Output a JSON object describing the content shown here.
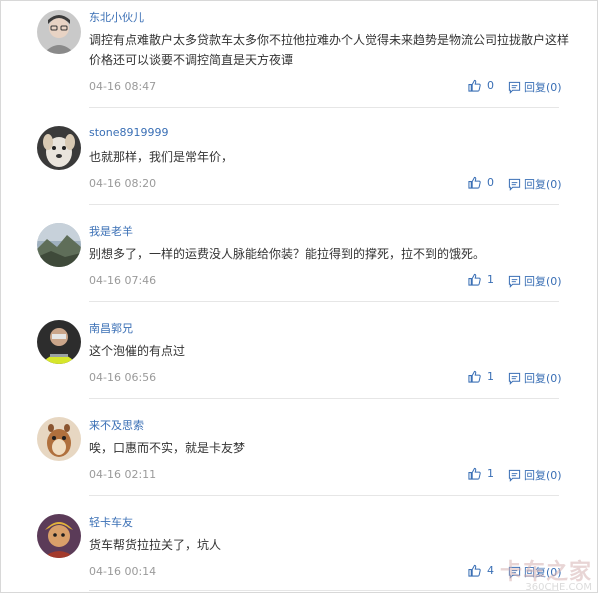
{
  "comments": [
    {
      "avatar": "avatar-person-glasses",
      "username": "东北小伙儿",
      "text": "调控有点难散户太多贷款车太多你不拉他拉难办个人觉得未来趋势是物流公司拉拢散户这样价格还可以谈要不调控简直是天方夜谭",
      "time": "04-16 08:47",
      "likes": "0",
      "reply": "回复(0)"
    },
    {
      "avatar": "avatar-dog",
      "username": "stone8919999",
      "text": "也就那样，我们是常年价，",
      "time": "04-16 08:20",
      "likes": "0",
      "reply": "回复(0)"
    },
    {
      "avatar": "avatar-landscape",
      "username": "我是老羊",
      "text": "别想多了，一样的运费没人脉能给你装？能拉得到的撑死，拉不到的饿死。",
      "time": "04-16 07:46",
      "likes": "1",
      "reply": "回复(0)"
    },
    {
      "avatar": "avatar-worker-vest",
      "username": "南昌郭兄",
      "text": "这个泡催的有点过",
      "time": "04-16 06:56",
      "likes": "1",
      "reply": "回复(0)"
    },
    {
      "avatar": "avatar-chipmunk",
      "username": "来不及思索",
      "text": "唉，口惠而不实，就是卡友梦",
      "time": "04-16 02:11",
      "likes": "1",
      "reply": "回复(0)"
    },
    {
      "avatar": "avatar-monkey-king",
      "username": "轻卡车友",
      "text": "货车帮货拉拉关了，坑人",
      "time": "04-16 00:14",
      "likes": "4",
      "reply": "回复(0)"
    }
  ],
  "watermark": {
    "logo": "卡车之家",
    "url": "360CHE.COM"
  },
  "colors": {
    "link": "#3a6fb5",
    "text": "#333333",
    "meta": "#9a9a9a"
  }
}
